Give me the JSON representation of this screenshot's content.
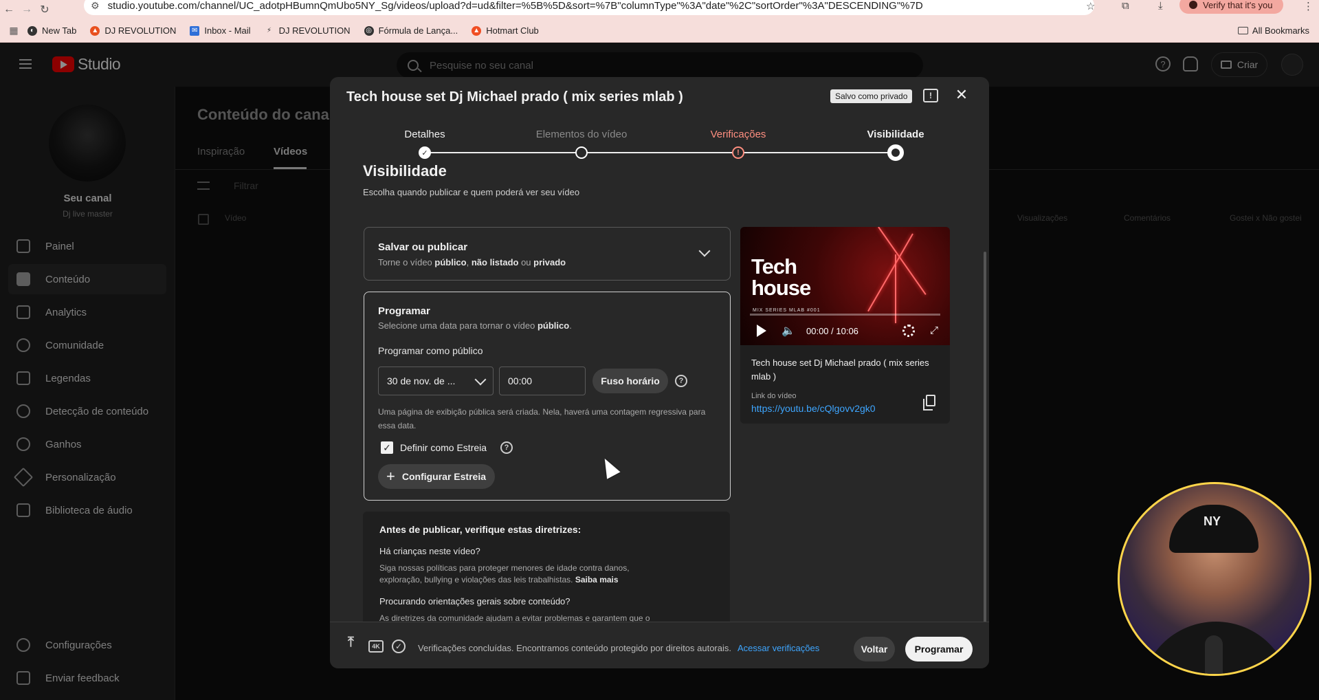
{
  "browser": {
    "url": "studio.youtube.com/channel/UC_adotpHBumnQmUbo5NY_Sg/videos/upload?d=ud&filter=%5B%5D&sort=%7B\"columnType\"%3A\"date\"%2C\"sortOrder\"%3A\"DESCENDING\"%7D",
    "verify_label": "Verify that it's you",
    "bookmarks": [
      "New Tab",
      "DJ REVOLUTION",
      "Inbox - Mail",
      "DJ REVOLUTION",
      "Fórmula de Lança...",
      "Hotmart Club"
    ],
    "all_bookmarks": "All Bookmarks"
  },
  "header": {
    "logo_text": "Studio",
    "search_placeholder": "Pesquise no seu canal",
    "create_label": "Criar"
  },
  "sidebar": {
    "channel_name": "Seu canal",
    "channel_handle": "Dj live master",
    "items": [
      {
        "label": "Painel"
      },
      {
        "label": "Conteúdo"
      },
      {
        "label": "Analytics"
      },
      {
        "label": "Comunidade"
      },
      {
        "label": "Legendas"
      },
      {
        "label": "Detecção de conteúdo"
      },
      {
        "label": "Ganhos"
      },
      {
        "label": "Personalização"
      },
      {
        "label": "Biblioteca de áudio"
      }
    ],
    "bottom_items": [
      {
        "label": "Configurações"
      },
      {
        "label": "Enviar feedback"
      }
    ]
  },
  "content": {
    "title": "Conteúdo do canal",
    "tabs": [
      "Inspiração",
      "Vídeos"
    ],
    "filter_label": "Filtrar",
    "columns": [
      "Vídeo",
      "Visualizações",
      "Comentários",
      "Gostei x Não gostei"
    ]
  },
  "modal": {
    "title": "Tech house set Dj Michael prado ( mix series mlab )",
    "saved_chip": "Salvo como privado",
    "steps": [
      {
        "label": "Detalhes",
        "state": "done",
        "color": "#f1f1f1"
      },
      {
        "label": "Elementos do vídeo",
        "state": "done",
        "color": "#8a8a8a"
      },
      {
        "label": "Verificações",
        "state": "warning",
        "color": "#ff8f80"
      },
      {
        "label": "Visibilidade",
        "state": "current",
        "color": "#f1f1f1"
      }
    ],
    "visibility": {
      "title": "Visibilidade",
      "subtitle": "Escolha quando publicar e quem poderá ver seu vídeo"
    },
    "save_publish": {
      "title": "Salvar ou publicar",
      "text_prefix": "Torne o vídeo ",
      "opt_public": "público",
      "sep1": ", ",
      "opt_unlisted": "não listado",
      "sep2": " ou ",
      "opt_private": "privado"
    },
    "schedule": {
      "title": "Programar",
      "text_prefix": "Selecione uma data para tornar o vídeo ",
      "text_bold": "público",
      "text_suffix": ".",
      "as_public_label": "Programar como público",
      "date_value": "30 de nov. de ...",
      "time_value": "00:00",
      "timezone_button": "Fuso horário",
      "note": "Uma página de exibição pública será criada. Nela, haverá uma contagem regressiva para essa data.",
      "premiere_checked": true,
      "premiere_label": "Definir como Estreia",
      "configure_premiere": "Configurar Estreia"
    },
    "guidelines": {
      "title": "Antes de publicar, verifique estas diretrizes:",
      "q1": "Há crianças neste vídeo?",
      "q1_text": "Siga nossas políticas para proteger menores de idade contra danos, exploração, bullying e violações das leis trabalhistas.",
      "q1_link": "Saiba mais",
      "q2": "Procurando orientações gerais sobre conteúdo?",
      "q2_text": "As diretrizes da comunidade ajudam a evitar problemas e garantem que o"
    },
    "preview": {
      "thumb_title_1": "Tech",
      "thumb_title_2": "house",
      "thumb_sub": "MIX SERIES MLAB #001",
      "time": "00:00 / 10:06",
      "progress": 0.0,
      "video_title": "Tech house set Dj Michael prado ( mix series mlab )",
      "link_label": "Link do vídeo",
      "link": "https://youtu.be/cQlgovv2gk0"
    },
    "footer": {
      "status": "Verificações concluídas. Encontramos conteúdo protegido por direitos autorais.",
      "status_link": "Acessar verificações",
      "back": "Voltar",
      "schedule": "Programar"
    }
  }
}
